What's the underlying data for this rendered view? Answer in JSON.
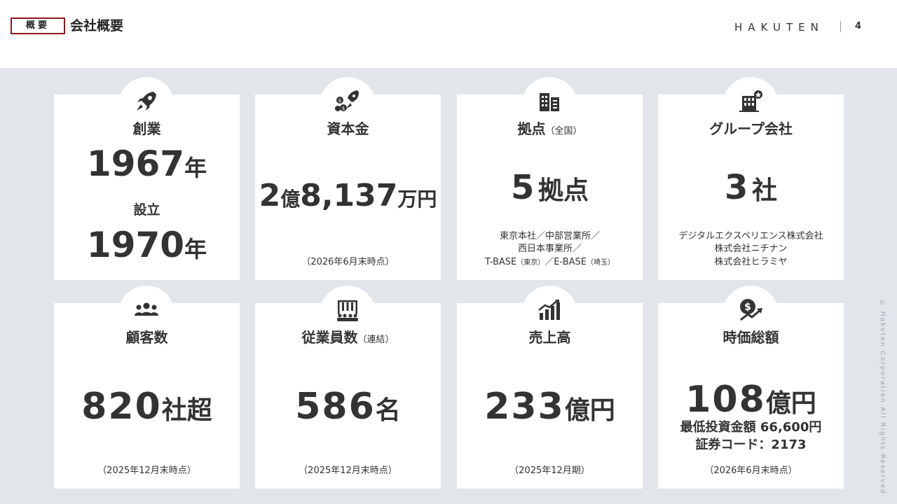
{
  "header": {
    "tag": "概要",
    "title": "会社概要",
    "logo": "HAKUTEN",
    "page_number": "4"
  },
  "cards": {
    "founded": {
      "title": "創業",
      "value": "1967",
      "unit": "年",
      "sub_label": "設立",
      "sub_value": "1970",
      "sub_unit": "年",
      "icon": "rocket-icon"
    },
    "capital": {
      "title": "資本金",
      "value_a": "2",
      "unit_a": "億",
      "value_b": "8,137",
      "unit_b": "万円",
      "note": "（2026年6月末時点）",
      "icon": "rocket-money-icon"
    },
    "locations": {
      "title": "拠点",
      "title_sub": "（全国）",
      "value": "5",
      "unit": "拠点",
      "note_line1": "東京本社／中部営業所／",
      "note_line2": "西日本事業所／",
      "note_line3a": "T-BASE",
      "note_line3b": "（東京）",
      "note_line3c": "／E-BASE",
      "note_line3d": "（埼玉）",
      "icon": "buildings-icon"
    },
    "group": {
      "title": "グループ会社",
      "value": "3",
      "unit": "社",
      "note_line1": "デジタルエクスペリエンス株式会社",
      "note_line2": "株式会社ニチナン",
      "note_line3": "株式会社ヒラミヤ",
      "icon": "group-building-icon"
    },
    "customers": {
      "title": "顧客数",
      "value": "820",
      "unit": "社超",
      "note": "（2025年12月末時点）",
      "icon": "people-icon"
    },
    "employees": {
      "title": "従業員数",
      "title_sub": "（連結）",
      "value": "586",
      "unit": "名",
      "note": "（2025年12月末時点）",
      "icon": "employees-icon"
    },
    "sales": {
      "title": "売上高",
      "value": "233",
      "unit": "億円",
      "note": "（2025年12月期）",
      "icon": "growth-chart-icon"
    },
    "market_cap": {
      "title": "時価総額",
      "value": "108",
      "unit": "億円",
      "detail_line1": "最低投資金額 66,600円",
      "detail_line2": "証券コード：2173",
      "note": "（2026年6月末時点）",
      "icon": "money-trend-icon"
    }
  },
  "copyright": "© Hakuten Corporation All Rights Reserved",
  "colors": {
    "accent_border": "#8b1a1a",
    "background_gray": "#e2e6ea",
    "text": "#333333"
  }
}
